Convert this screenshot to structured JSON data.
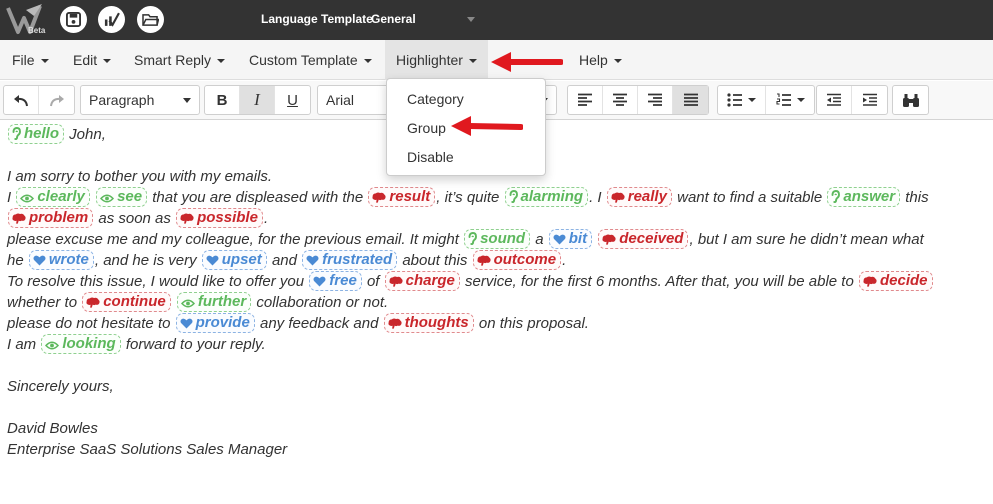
{
  "app": {
    "logo_badge": "Beta",
    "template_label": "Language Template",
    "template_value": "General"
  },
  "menu": {
    "items": [
      {
        "label": "File"
      },
      {
        "label": "Edit"
      },
      {
        "label": "Smart Reply"
      },
      {
        "label": "Custom Template"
      },
      {
        "label": "Highlighter"
      },
      {
        "label": "Help"
      }
    ]
  },
  "toolbar": {
    "block_format": "Paragraph",
    "font_family": "Arial"
  },
  "highlighter_menu": {
    "items": [
      "Category",
      "Group",
      "Disable"
    ]
  },
  "colors": {
    "green": "#5cb85c",
    "blue": "#4a8ad4",
    "red": "#c9262b",
    "arrow": "#e0191f"
  },
  "email": {
    "lines": [
      [
        {
          "tag": "g",
          "icon": "ear-icon",
          "text": "hello"
        },
        {
          "t": " John,"
        }
      ],
      [],
      [
        {
          "t": "I am sorry to bother you with my emails."
        }
      ],
      [
        {
          "t": "I "
        },
        {
          "tag": "g",
          "icon": "eye-icon",
          "text": "clearly"
        },
        {
          "t": " "
        },
        {
          "tag": "g",
          "icon": "eye-icon",
          "text": "see"
        },
        {
          "t": " that you are displeased with the "
        },
        {
          "tag": "r",
          "icon": "brain-icon",
          "text": "result"
        },
        {
          "t": ", it’s quite "
        },
        {
          "tag": "g",
          "icon": "ear-icon",
          "text": "alarming"
        },
        {
          "t": ". I "
        },
        {
          "tag": "r",
          "icon": "brain-icon",
          "text": "really"
        },
        {
          "t": " want to find a suitable "
        },
        {
          "tag": "g",
          "icon": "ear-icon",
          "text": "answer"
        },
        {
          "t": " this"
        }
      ],
      [
        {
          "tag": "r",
          "icon": "brain-icon",
          "text": "problem"
        },
        {
          "t": " as soon as "
        },
        {
          "tag": "r",
          "icon": "brain-icon",
          "text": "possible"
        },
        {
          "t": "."
        }
      ],
      [
        {
          "t": "please excuse me and my colleague, for the previous email. It might "
        },
        {
          "tag": "g",
          "icon": "ear-icon",
          "text": "sound"
        },
        {
          "t": " a "
        },
        {
          "tag": "b",
          "icon": "heart-icon",
          "text": "bit"
        },
        {
          "t": " "
        },
        {
          "tag": "r",
          "icon": "brain-icon",
          "text": "deceived"
        },
        {
          "t": ", but I am sure he didn’t mean what"
        }
      ],
      [
        {
          "t": "he "
        },
        {
          "tag": "b",
          "icon": "heart-icon",
          "text": "wrote"
        },
        {
          "t": ", and he is very "
        },
        {
          "tag": "b",
          "icon": "heart-icon",
          "text": "upset"
        },
        {
          "t": " and "
        },
        {
          "tag": "b",
          "icon": "heart-icon",
          "text": "frustrated"
        },
        {
          "t": " about this "
        },
        {
          "tag": "r",
          "icon": "brain-icon",
          "text": "outcome"
        },
        {
          "t": "."
        }
      ],
      [
        {
          "t": "To resolve this issue, I would like to offer you "
        },
        {
          "tag": "b",
          "icon": "heart-icon",
          "text": "free"
        },
        {
          "t": " of "
        },
        {
          "tag": "r",
          "icon": "brain-icon",
          "text": "charge"
        },
        {
          "t": " service, for the first 6 months. After that, you will be able to "
        },
        {
          "tag": "r",
          "icon": "brain-icon",
          "text": "decide"
        }
      ],
      [
        {
          "t": "whether to "
        },
        {
          "tag": "r",
          "icon": "brain-icon",
          "text": "continue"
        },
        {
          "t": " "
        },
        {
          "tag": "g",
          "icon": "eye-icon",
          "text": "further"
        },
        {
          "t": " collaboration or not."
        }
      ],
      [
        {
          "t": "please do not hesitate to "
        },
        {
          "tag": "b",
          "icon": "heart-icon",
          "text": "provide"
        },
        {
          "t": " any feedback and "
        },
        {
          "tag": "r",
          "icon": "brain-icon",
          "text": "thoughts"
        },
        {
          "t": " on this proposal."
        }
      ],
      [
        {
          "t": "I am "
        },
        {
          "tag": "g",
          "icon": "eye-icon",
          "text": "looking"
        },
        {
          "t": " forward to your reply."
        }
      ],
      [],
      [
        {
          "t": "Sincerely yours,"
        }
      ],
      [],
      [
        {
          "t": "David Bowles"
        }
      ],
      [
        {
          "t": "Enterprise SaaS Solutions Sales Manager"
        }
      ]
    ]
  }
}
